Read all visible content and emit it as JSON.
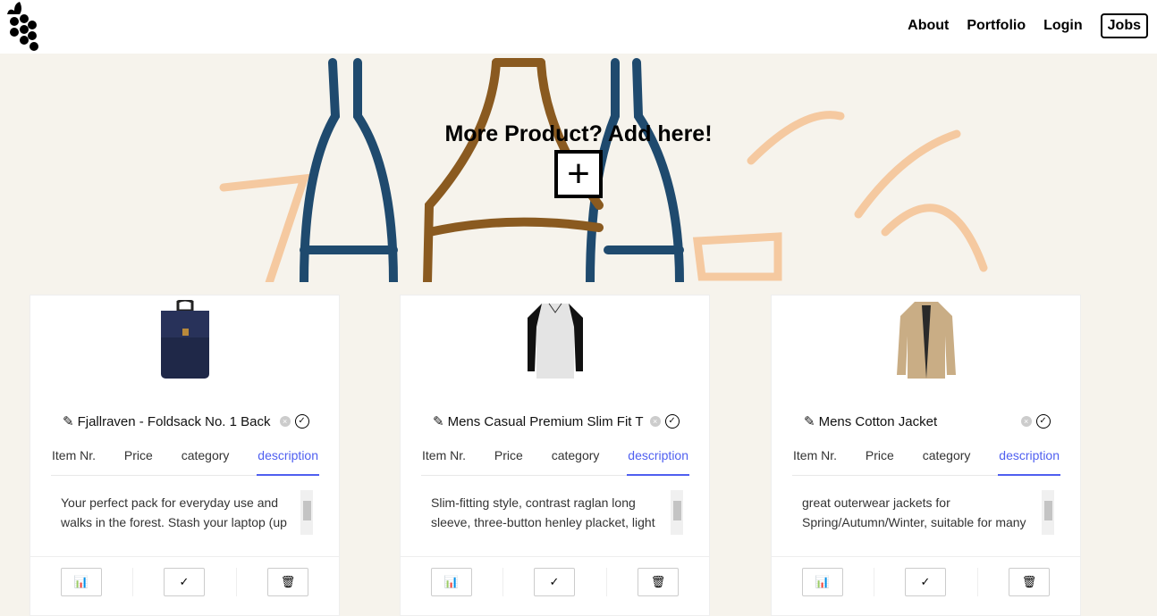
{
  "nav": {
    "links": [
      "About",
      "Portfolio",
      "Login",
      "Jobs"
    ]
  },
  "hero": {
    "heading": "More Product? Add here!",
    "add_icon": "plus-icon"
  },
  "colors": {
    "accent": "#4f5ff0",
    "background": "#f6f3ec"
  },
  "products": [
    {
      "title": "Fjallraven - Foldsack No. 1 Back",
      "tabs": [
        "Item Nr.",
        "Price",
        "category",
        "description"
      ],
      "active_tab": "description",
      "description": "Your perfect pack for everyday use and walks in the forest. Stash your laptop (up",
      "image": "backpack"
    },
    {
      "title": "Mens Casual Premium Slim Fit T",
      "tabs": [
        "Item Nr.",
        "Price",
        "category",
        "description"
      ],
      "active_tab": "description",
      "description": "Slim-fitting style, contrast raglan long sleeve, three-button henley placket, light",
      "image": "t-shirt"
    },
    {
      "title": "Mens Cotton Jacket",
      "tabs": [
        "Item Nr.",
        "Price",
        "category",
        "description"
      ],
      "active_tab": "description",
      "description": "great outerwear jackets for Spring/Autumn/Winter, suitable for many",
      "image": "jacket"
    }
  ]
}
